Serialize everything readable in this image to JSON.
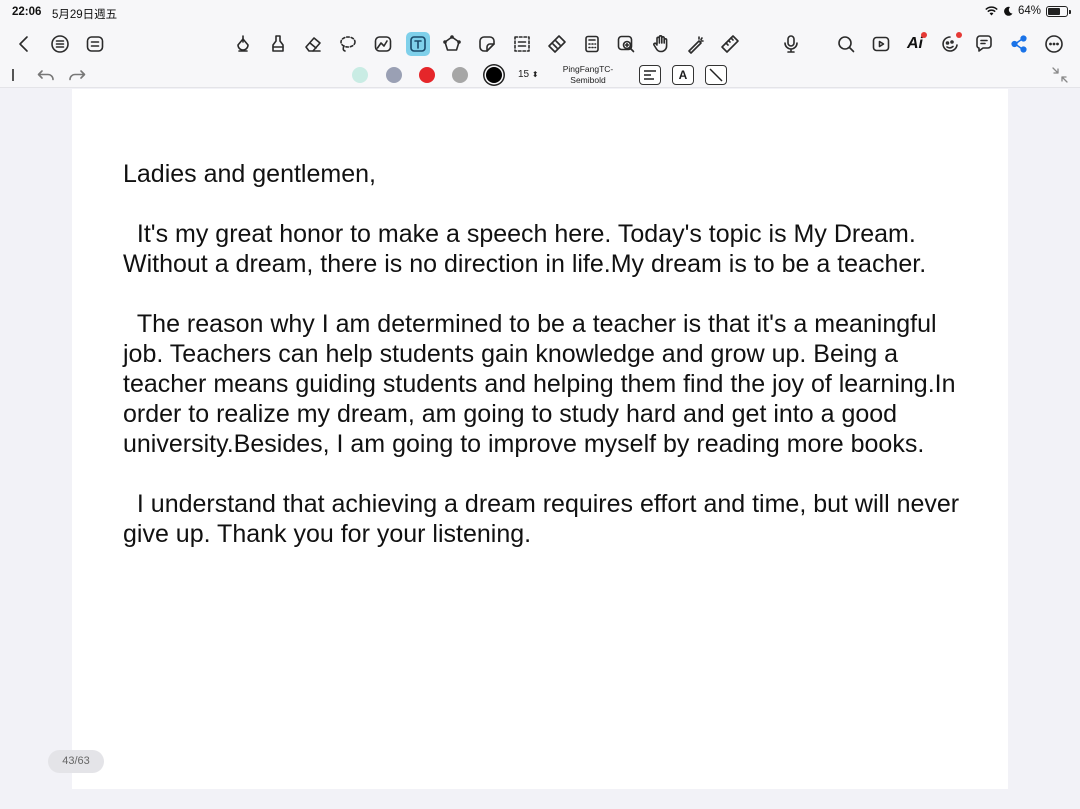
{
  "status_bar": {
    "time": "22:06",
    "date": "5月29日週五",
    "battery_text": "64%",
    "battery_level": 0.64
  },
  "toolbar": {
    "left_icons": [
      "back-icon",
      "outline-list-icon",
      "page-menu-icon"
    ],
    "tool_icons": [
      "pen-icon",
      "highlighter-icon",
      "eraser-icon",
      "lasso-icon",
      "image-icon",
      "text-tool-icon",
      "shape-icon",
      "sticker-icon",
      "selection-icon",
      "tape-icon",
      "calculator-icon",
      "zoom-window-icon",
      "hand-icon",
      "laser-pointer-icon",
      "ruler-icon"
    ],
    "active_tool": "text-tool-icon",
    "right_icons": [
      "microphone-icon",
      "search-icon",
      "presentation-icon",
      "ai-icon",
      "assistant-icon",
      "comments-icon",
      "share-icon",
      "more-icon"
    ],
    "ai_label": "Ai"
  },
  "text_options": {
    "colors": [
      "#c9ece4",
      "#9aa0b4",
      "#e5262a",
      "#a6a6a6",
      "#000000"
    ],
    "selected_color": "#000000",
    "font_size": "15",
    "font_name_line1": "PingFangTC-",
    "font_name_line2": "Semibold",
    "bold_label": "A"
  },
  "document": {
    "paragraphs": [
      "Ladies and gentlemen,",
      "  It's my great honor to make a speech here. Today's topic is My Dream. Without a dream, there is no direction in life.My dream is to be a teacher.",
      "  The reason why I am determined to be a teacher is that it's a meaningful job. Teachers can help students gain knowledge and grow up. Being a teacher means guiding students and helping them find the joy of learning.In order to realize my dream, am going to study hard and get into a good university.Besides, I am going to improve myself by reading more books.",
      "  I understand that achieving a dream requires effort and time, but will never give up. Thank you for your listening."
    ],
    "page_indicator": "43/63"
  }
}
